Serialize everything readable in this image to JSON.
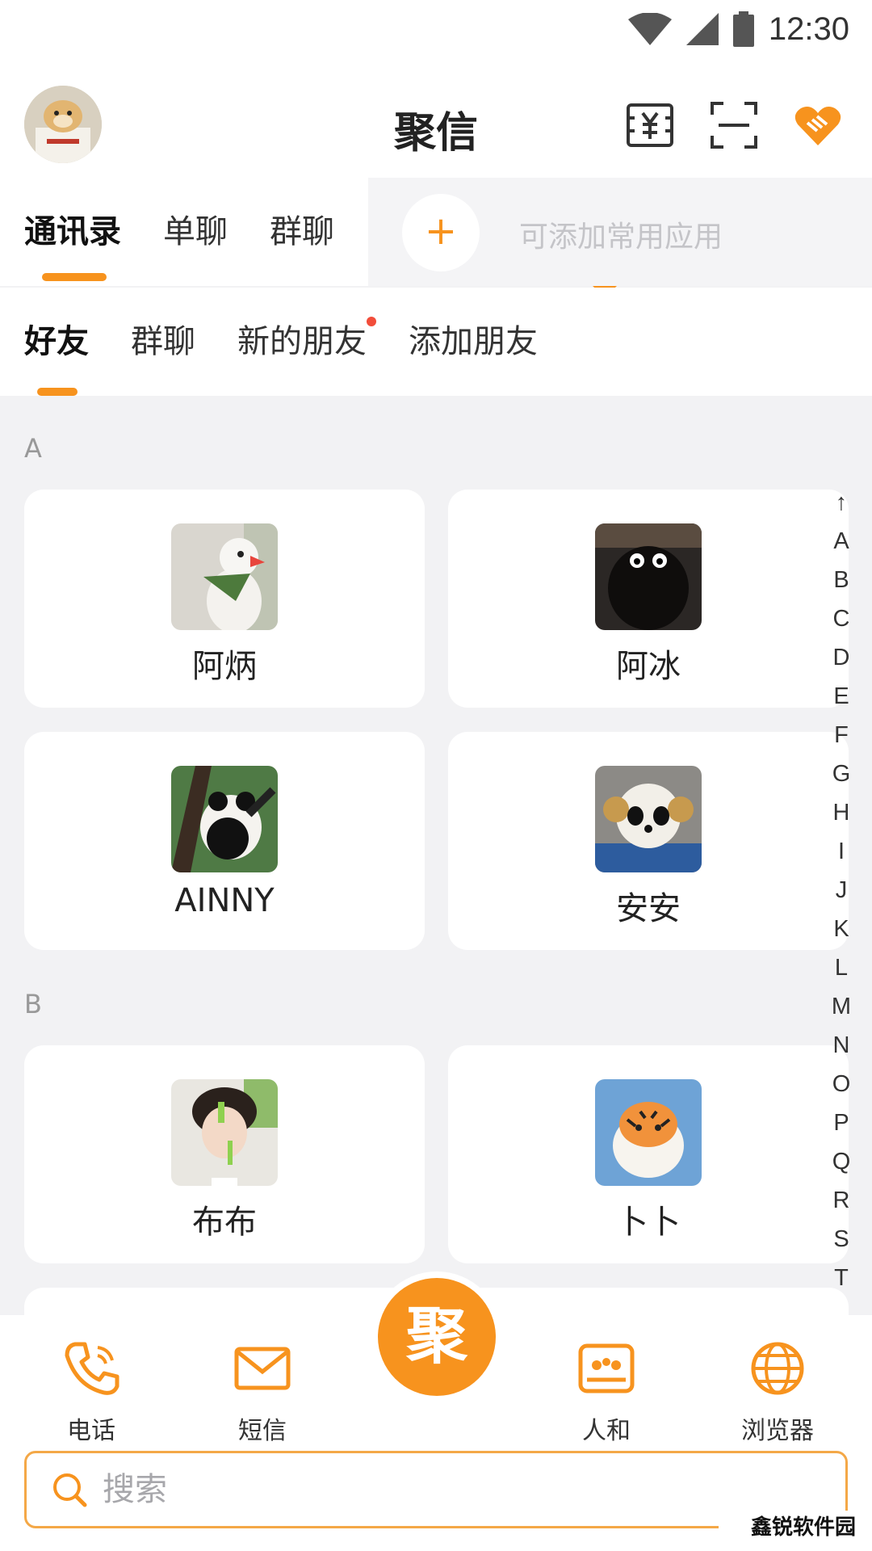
{
  "status_bar": {
    "time": "12:30",
    "icons": [
      "wifi-icon",
      "signal-icon",
      "battery-icon"
    ]
  },
  "header": {
    "title": "聚信",
    "icons": [
      "wallet-icon",
      "scan-icon",
      "handshake-heart-icon"
    ]
  },
  "main_tabs": [
    "通讯录",
    "单聊",
    "群聊"
  ],
  "apps": {
    "add_hint": "可添加常用应用",
    "add_symbol": "+"
  },
  "sub_tabs": [
    "好友",
    "群聊",
    "新的朋友",
    "添加朋友"
  ],
  "sections": [
    {
      "letter": "A",
      "contacts": [
        "阿炳",
        "阿冰",
        "AINNY",
        "安安"
      ]
    },
    {
      "letter": "B",
      "contacts": [
        "布布",
        "卜卜"
      ]
    }
  ],
  "index_bar": [
    "↑",
    "A",
    "B",
    "C",
    "D",
    "E",
    "F",
    "G",
    "H",
    "I",
    "J",
    "K",
    "L",
    "M",
    "N",
    "O",
    "P",
    "Q",
    "R",
    "S",
    "T"
  ],
  "bottom_nav": {
    "phone": "电话",
    "sms": "短信",
    "center": "聚",
    "renhe": "人和",
    "browser": "浏览器"
  },
  "search": {
    "placeholder": "搜索"
  },
  "watermark": "鑫锐软件园",
  "colors": {
    "accent": "#f7931e",
    "background": "#f2f2f4",
    "card": "#ffffff"
  }
}
